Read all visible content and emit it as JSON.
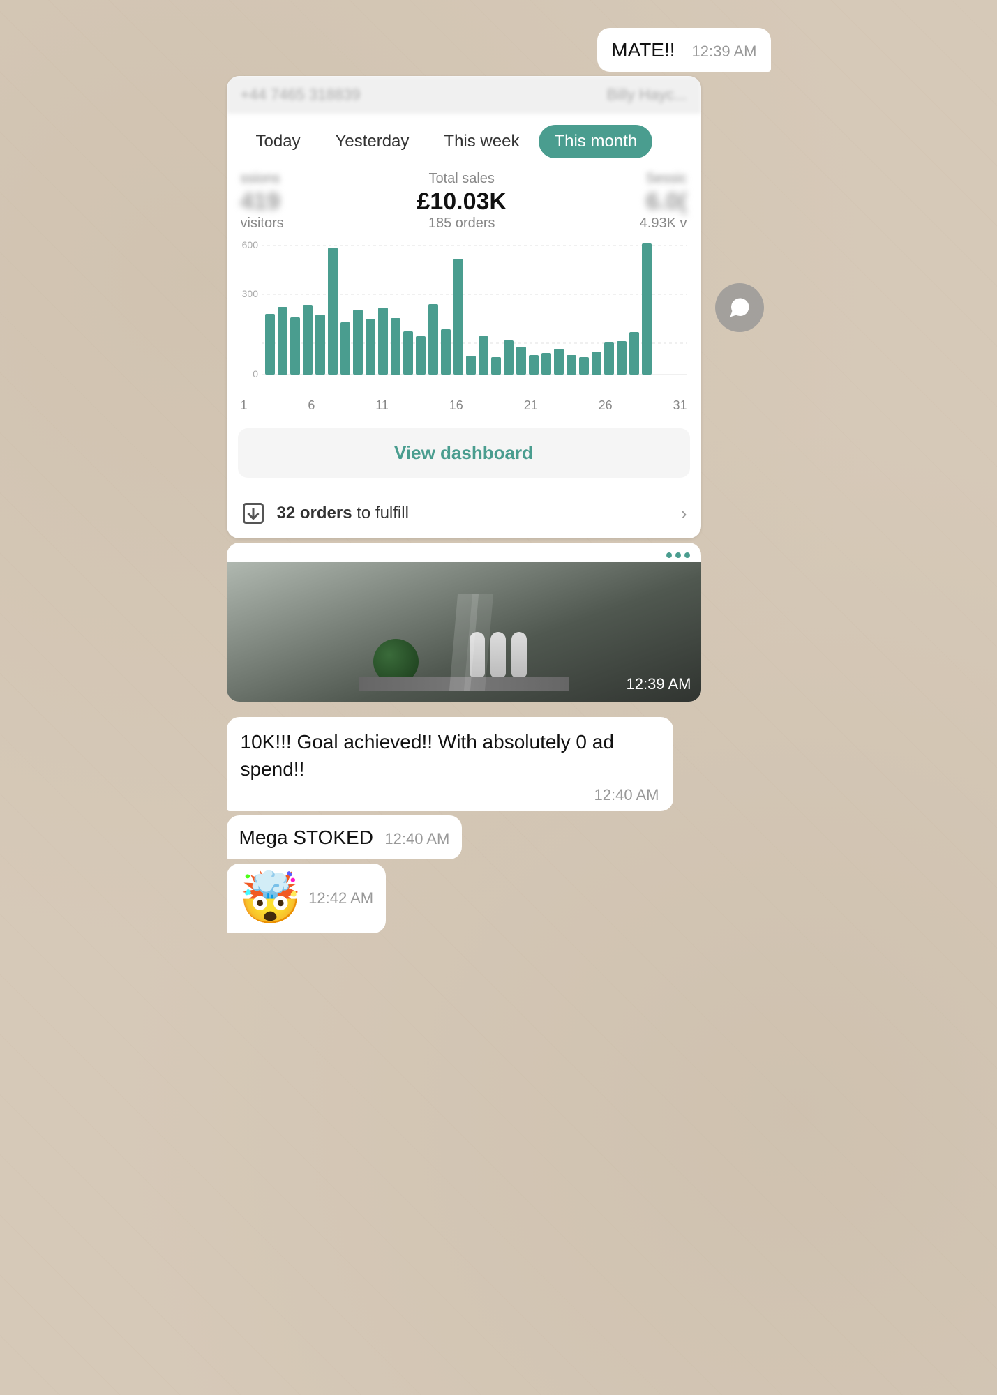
{
  "chat": {
    "background_color": "#d6c9b8",
    "messages": [
      {
        "id": "mate-msg",
        "text": "MATE!!",
        "time": "12:39 AM",
        "side": "right"
      },
      {
        "id": "dashboard-card",
        "type": "card",
        "topbar_text": "+44 7465 318839",
        "topbar_name": "Billy Hayc...",
        "tabs": [
          "Today",
          "Yesterday",
          "This week",
          "This month"
        ],
        "active_tab": "This month",
        "stats": {
          "left_label": "ssions",
          "left_value": "419",
          "left_sub": "visitors",
          "center_label": "Total sales",
          "center_value": "£10.03K",
          "center_sub": "185 orders",
          "right_label": "Sessic",
          "right_value": "6.0(",
          "right_sub": "4.93K v"
        },
        "chart": {
          "y_labels": [
            "600",
            "300",
            "0"
          ],
          "x_labels": [
            "1",
            "6",
            "11",
            "16",
            "21",
            "26",
            "31"
          ],
          "bars": [
            270,
            310,
            260,
            320,
            280,
            590,
            240,
            300,
            260,
            310,
            260,
            200,
            180,
            320,
            210,
            540,
            90,
            180,
            80,
            160,
            130,
            90,
            100,
            120,
            90,
            80,
            110,
            150,
            160,
            200,
            620
          ],
          "bar_color": "#4a9d8f",
          "accent_color": "#4a9d8f"
        },
        "view_dashboard_label": "View dashboard",
        "orders_text": "32 orders",
        "orders_suffix": "to fulfill"
      },
      {
        "id": "media-card",
        "type": "media",
        "dots_color": "#4a9d8f",
        "time": "12:39 AM"
      },
      {
        "id": "achievement-msg",
        "text": "10K!!! Goal achieved!! With absolutely 0 ad spend!!",
        "time": "12:40 AM",
        "side": "left"
      },
      {
        "id": "mega-stoked-msg",
        "text": "Mega STOKED",
        "time": "12:40 AM",
        "side": "left"
      },
      {
        "id": "emoji-msg",
        "emoji": "🤯",
        "time": "12:42 AM",
        "side": "left"
      }
    ],
    "colors": {
      "active_tab_bg": "#4a9d8f",
      "active_tab_text": "#ffffff",
      "tab_text": "#333333",
      "chart_bar": "#4a9d8f",
      "dashboard_btn_text": "#4a9d8f",
      "dashboard_btn_bg": "#f5f5f5"
    }
  }
}
